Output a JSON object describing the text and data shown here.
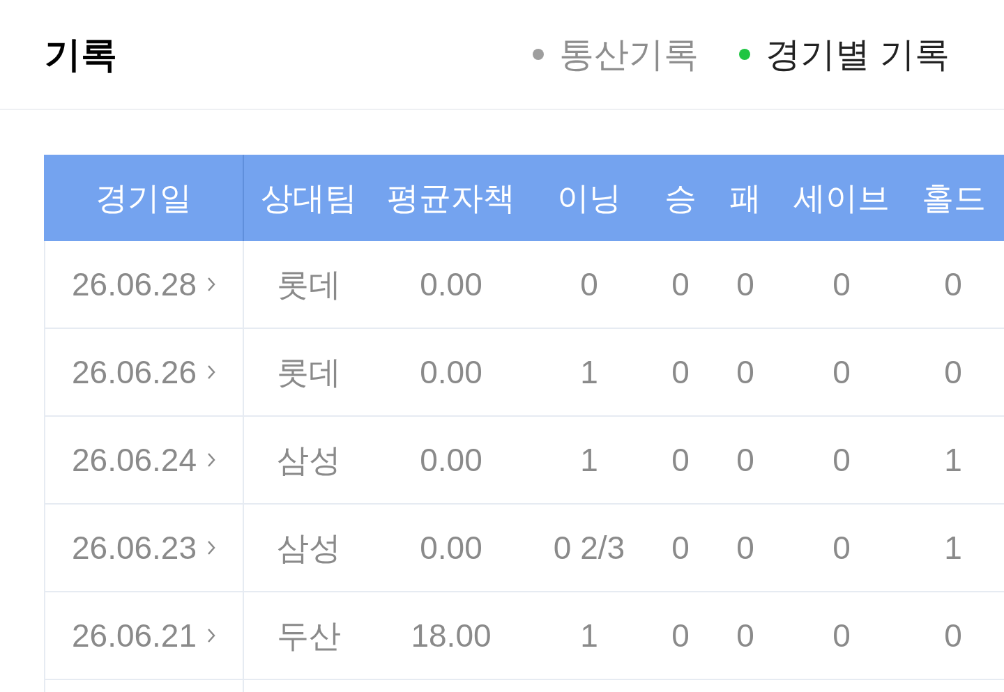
{
  "title": "기록",
  "tabs": [
    {
      "label": "통산기록",
      "selected": false
    },
    {
      "label": "경기별 기록",
      "selected": true
    }
  ],
  "table": {
    "columns": [
      "경기일",
      "상대팀",
      "평균자책",
      "이닝",
      "승",
      "패",
      "세이브",
      "홀드"
    ],
    "rows": [
      {
        "cells": [
          "26.06.28",
          "롯데",
          "0.00",
          "0",
          "0",
          "0",
          "0",
          "0"
        ]
      },
      {
        "cells": [
          "26.06.26",
          "롯데",
          "0.00",
          "1",
          "0",
          "0",
          "0",
          "0"
        ]
      },
      {
        "cells": [
          "26.06.24",
          "삼성",
          "0.00",
          "1",
          "0",
          "0",
          "0",
          "1"
        ]
      },
      {
        "cells": [
          "26.06.23",
          "삼성",
          "0.00",
          "0 2/3",
          "0",
          "0",
          "0",
          "1"
        ]
      },
      {
        "cells": [
          "26.06.21",
          "두산",
          "18.00",
          "1",
          "0",
          "0",
          "0",
          "0"
        ]
      }
    ]
  }
}
